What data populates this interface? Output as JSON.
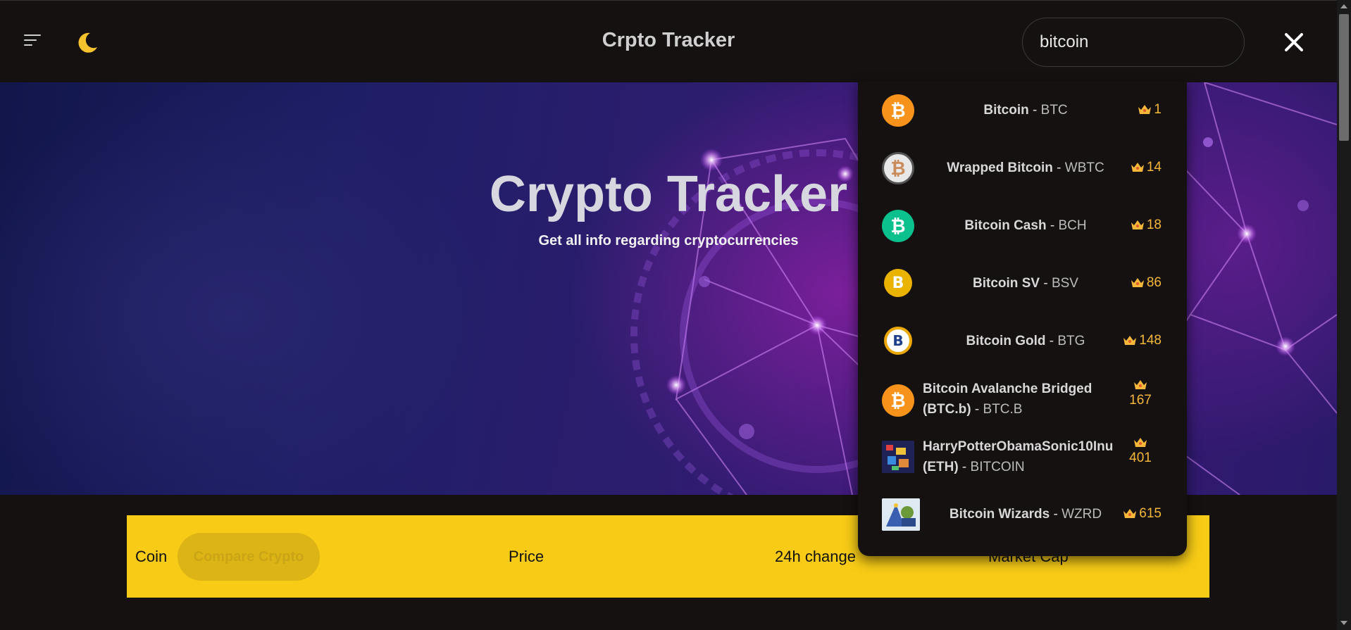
{
  "navbar": {
    "title": "Crpto Tracker",
    "search_value": "bitcoin"
  },
  "hero": {
    "title": "Crypto Tracker",
    "subtitle": "Get all info regarding cryptocurrencies"
  },
  "table": {
    "columns": [
      "Coin",
      "Price",
      "24h change",
      "Market Cap"
    ],
    "compare_label": "Compare Crypto"
  },
  "search_results": [
    {
      "name": "Bitcoin",
      "symbol": "BTC",
      "rank": "1",
      "icon": "bitcoin-logo",
      "color": "#f7931a"
    },
    {
      "name": "Wrapped Bitcoin",
      "symbol": "WBTC",
      "rank": "14",
      "icon": "wrapped-bitcoin-logo",
      "color": "#e8e8e8"
    },
    {
      "name": "Bitcoin Cash",
      "symbol": "BCH",
      "rank": "18",
      "icon": "bitcoin-cash-logo",
      "color": "#0ac18e"
    },
    {
      "name": "Bitcoin SV",
      "symbol": "BSV",
      "rank": "86",
      "icon": "bitcoin-sv-logo",
      "color": "#eab300"
    },
    {
      "name": "Bitcoin Gold",
      "symbol": "BTG",
      "rank": "148",
      "icon": "bitcoin-gold-logo",
      "color": "#eba809"
    },
    {
      "name": "Bitcoin Avalanche Bridged (BTC.b)",
      "symbol": "BTC.B",
      "rank": "167",
      "icon": "bitcoin-avalanche-logo",
      "color": "#f7931a"
    },
    {
      "name": "HarryPotterObamaSonic10Inu (ETH)",
      "symbol": "BITCOIN",
      "rank": "401",
      "icon": "harrypotter-coin-logo",
      "color": "#2a3a8a"
    },
    {
      "name": "Bitcoin Wizards",
      "symbol": "WZRD",
      "rank": "615",
      "icon": "bitcoin-wizards-logo",
      "color": "#3a6fb0"
    }
  ],
  "colors": {
    "background": "#151110",
    "accent_yellow": "#f7cb16",
    "rank_gold": "#f4b73a",
    "hero_purple": "#7a1f9a"
  }
}
